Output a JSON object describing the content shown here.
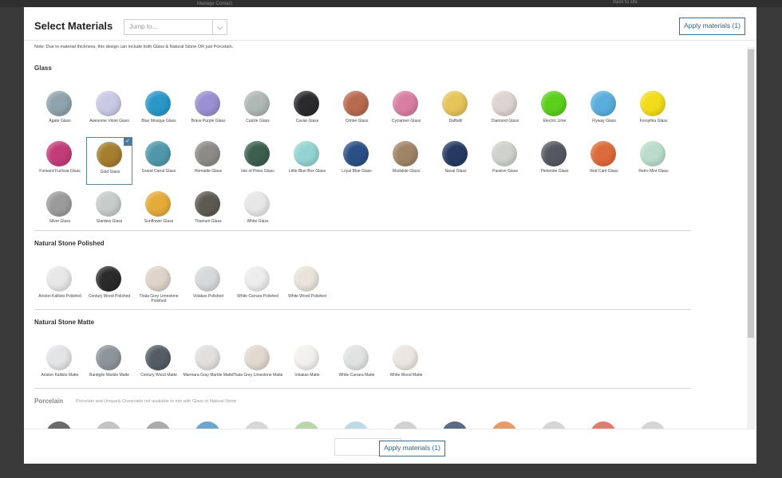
{
  "background": {
    "top_text": "Manage Contact",
    "right_text": "Back to site"
  },
  "header": {
    "title": "Select Materials",
    "jump_placeholder": "Jump to...",
    "apply_label": "Apply materials (1)"
  },
  "note": "Note: Due to material thickness, this design can include both Glass & Natural Stone OR just Porcelain.",
  "sections": {
    "glass": {
      "title": "Glass",
      "items": [
        {
          "label": "Agate Glass",
          "color": "#8ea3ad"
        },
        {
          "label": "Awesome Violet Glass",
          "color": "#c8c9e4"
        },
        {
          "label": "Blue Mosque Glass",
          "color": "#2a97c9"
        },
        {
          "label": "Brave Purple Glass",
          "color": "#9a8fd0"
        },
        {
          "label": "Calcite Glass",
          "color": "#aeb8b4"
        },
        {
          "label": "Caviar Glass",
          "color": "#2b2b2e"
        },
        {
          "label": "Citrine Glass",
          "color": "#b86a4e"
        },
        {
          "label": "Cyclamen Glass",
          "color": "#d87ea0"
        },
        {
          "label": "Daffodil",
          "color": "#e6c45a"
        },
        {
          "label": "Diamond Glass",
          "color": "#ddd3d0"
        },
        {
          "label": "Electric Lime",
          "color": "#5ccf1c"
        },
        {
          "label": "Flyway Glass",
          "color": "#5aaedc"
        },
        {
          "label": "Forsythia Glass",
          "color": "#f2dc1a"
        },
        {
          "label": "Forward Fuchsia Glass",
          "color": "#c23c78"
        },
        {
          "label": "Gold Glass",
          "color": "#a47d2e",
          "selected": true
        },
        {
          "label": "Grand Canal Glass",
          "color": "#4f98ab"
        },
        {
          "label": "Hematite Glass",
          "color": "#8d8b88"
        },
        {
          "label": "Isle of Pines Glass",
          "color": "#3d5f4d"
        },
        {
          "label": "Little Blue Box Glass",
          "color": "#93d4d2"
        },
        {
          "label": "Loyal Blue Glass",
          "color": "#2b4f85"
        },
        {
          "label": "Mudslide Glass",
          "color": "#a08466"
        },
        {
          "label": "Naval Glass",
          "color": "#263a61"
        },
        {
          "label": "Passive Glass",
          "color": "#cfd1cc"
        },
        {
          "label": "Pietersite Glass",
          "color": "#555761"
        },
        {
          "label": "Red Carit Glass",
          "color": "#dc6a3a"
        },
        {
          "label": "Retro Mint Glass",
          "color": "#b9dccb"
        },
        {
          "label": "Silver Glass",
          "color": "#9b9b9b"
        },
        {
          "label": "Stardew Glass",
          "color": "#c6ccc9"
        },
        {
          "label": "Sunflower Glass",
          "color": "#e5ab3a"
        },
        {
          "label": "Titanium Glass",
          "color": "#5d5a53"
        },
        {
          "label": "White Glass",
          "color": "#e7e7e7"
        }
      ]
    },
    "stone_polished": {
      "title": "Natural Stone Polished",
      "items": [
        {
          "label": "Ariston Kallisto Polished",
          "color": "#e7e7e8"
        },
        {
          "label": "Century Wood Polished",
          "color": "#2b2b2c"
        },
        {
          "label": "Thala Grey Limestone Polished",
          "color": "#ddd3c7"
        },
        {
          "label": "Volakas Polished",
          "color": "#d7d8d9"
        },
        {
          "label": "White Carrara Polished",
          "color": "#ececec"
        },
        {
          "label": "White Wood Polished",
          "color": "#e9e3da"
        }
      ]
    },
    "stone_matte": {
      "title": "Natural Stone Matte",
      "items": [
        {
          "label": "Ariston Kallisto Matte",
          "color": "#e3e4e5"
        },
        {
          "label": "Bardiglio Marble Matte",
          "color": "#8d959b"
        },
        {
          "label": "Century Wood Matte",
          "color": "#555c65"
        },
        {
          "label": "Marmara Gray Marble Matte",
          "color": "#e1e0df"
        },
        {
          "label": "Thala Grey Limestone Matte",
          "color": "#e1d9d0"
        },
        {
          "label": "Volakas Matte",
          "color": "#f2f1ef"
        },
        {
          "label": "White Carrara Matte",
          "color": "#e1e2e2"
        },
        {
          "label": "White Wood Matte",
          "color": "#ebe6df"
        }
      ]
    },
    "porcelain": {
      "title": "Porcelain",
      "note": "Porcelain and Uniquely Oceanside not available to mix with Glass or Natural Stone",
      "partial_colors": [
        "#6b6b6b",
        "#c4c4c4",
        "#a9aaad",
        "#6aa8cf",
        "#d7d7d7",
        "#b9d7ad",
        "#bfd9e6",
        "#cfd1d3",
        "#5c6b85",
        "#e79b6a",
        "#d6d6d6",
        "#e27a6d",
        "#d5d5d5"
      ]
    }
  },
  "footer": {
    "apply_label": "Apply materials (1)"
  }
}
